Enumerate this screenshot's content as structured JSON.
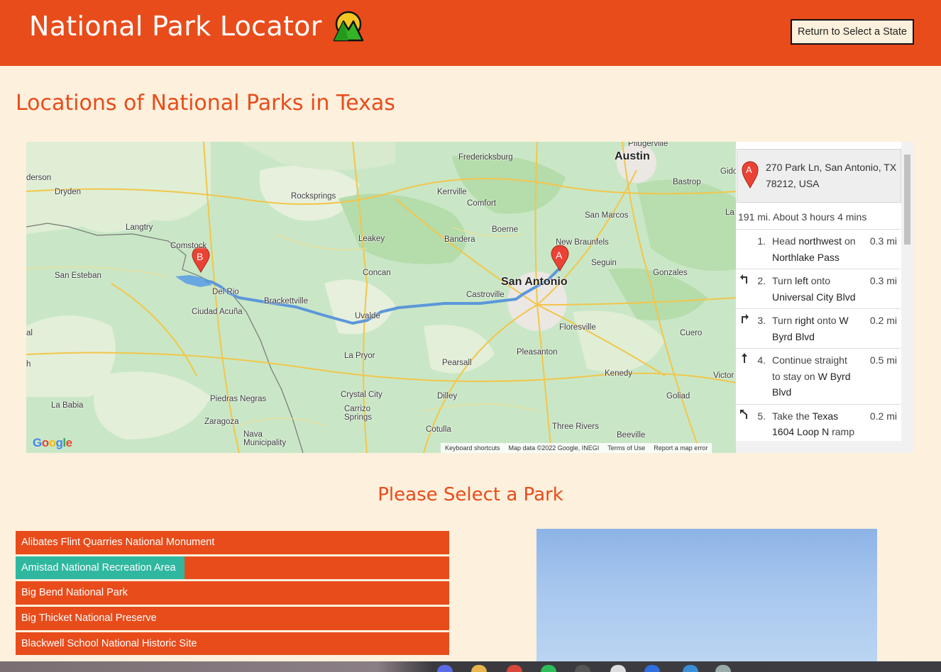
{
  "header": {
    "title": "National Park Locator",
    "logo_icon": "mountain-sun-icon",
    "return_button": "Return to Select a State"
  },
  "page_heading": "Locations of National Parks in Texas",
  "map": {
    "labels": {
      "austin": "Austin",
      "san_antonio": "San Antonio",
      "fredericksburg": "Fredericksburg",
      "kerrville": "Kerrville",
      "comfort": "Comfort",
      "rocksprings": "Rocksprings",
      "dryden": "Dryden",
      "derson": "derson",
      "langtry": "Langtry",
      "comstock": "Comstock",
      "san_esteban": "San Esteban",
      "del_rio": "Del Rio",
      "ciudad_acuna": "Ciudad Acuña",
      "brackettville": "Brackettville",
      "uvalde": "Uvalde",
      "leakey": "Leakey",
      "concan": "Concan",
      "bandera": "Bandera",
      "boerne": "Boerne",
      "castroville": "Castroville",
      "new_braunfels": "New Braunfels",
      "san_marcos": "San Marcos",
      "seguin": "Seguin",
      "gonzales": "Gonzales",
      "bastrop": "Bastrop",
      "pflugerville": "Pflugerville",
      "floresville": "Floresville",
      "pleasanton": "Pleasanton",
      "la_pryor": "La Pryor",
      "pearsall": "Pearsall",
      "dilley": "Dilley",
      "crystal_city": "Crystal City",
      "carrizo_springs": "Carrizo Springs",
      "piedras_negras": "Piedras Negras",
      "zaragoza": "Zaragoza",
      "nava": "Nava Municipality",
      "cotulla": "Cotulla",
      "three_rivers": "Three Rivers",
      "kenedy": "Kenedy",
      "goliad": "Goliad",
      "beeville": "Beeville",
      "cuero": "Cuero",
      "la_babia": "La Babia",
      "victor": "Victor",
      "gido": "Gido",
      "la": "La",
      "al": "al",
      "h": "h"
    },
    "markers": {
      "a": "A",
      "b": "B"
    },
    "footer": {
      "shortcuts": "Keyboard shortcuts",
      "data": "Map data ©2022 Google, INEGI",
      "terms": "Terms of Use",
      "report": "Report a map error"
    },
    "google": "Google"
  },
  "directions": {
    "origin_marker": "A",
    "origin": "270 Park Ln, San Antonio, TX 78212, USA",
    "summary": "191 mi. About 3 hours 4 mins",
    "steps": [
      {
        "num": "1.",
        "pre": "Head ",
        "b1": "northwest",
        "mid": " on ",
        "b2": "Northlake Pass",
        "post": "",
        "dist": "0.3 mi",
        "icon": ""
      },
      {
        "num": "2.",
        "pre": "Turn ",
        "b1": "left",
        "mid": " onto ",
        "b2": "Universal City Blvd",
        "post": "",
        "dist": "0.3 mi",
        "icon": "turn-left-icon"
      },
      {
        "num": "3.",
        "pre": "Turn ",
        "b1": "right",
        "mid": " onto ",
        "b2": "W Byrd Blvd",
        "post": "",
        "dist": "0.2 mi",
        "icon": "turn-right-icon"
      },
      {
        "num": "4.",
        "pre": "Continue straight to stay on ",
        "b1": "W Byrd Blvd",
        "mid": "",
        "b2": "",
        "post": "",
        "dist": "0.5 mi",
        "icon": "straight-icon"
      },
      {
        "num": "5.",
        "pre": "Take the ",
        "b1": "Texas 1604 Loop N",
        "mid": " ramp",
        "b2": "",
        "post": "",
        "dist": "0.2 mi",
        "icon": "ramp-left-icon"
      }
    ]
  },
  "select_heading": "Please Select a Park",
  "parks": [
    "Alibates Flint Quarries National Monument",
    "Amistad National Recreation Area",
    "Big Bend National Park",
    "Big Thicket National Preserve",
    "Blackwell School National Historic Site"
  ],
  "colors": {
    "accent": "#e84c1b",
    "background": "#fdf0dc",
    "hover": "#2fb7a0"
  }
}
